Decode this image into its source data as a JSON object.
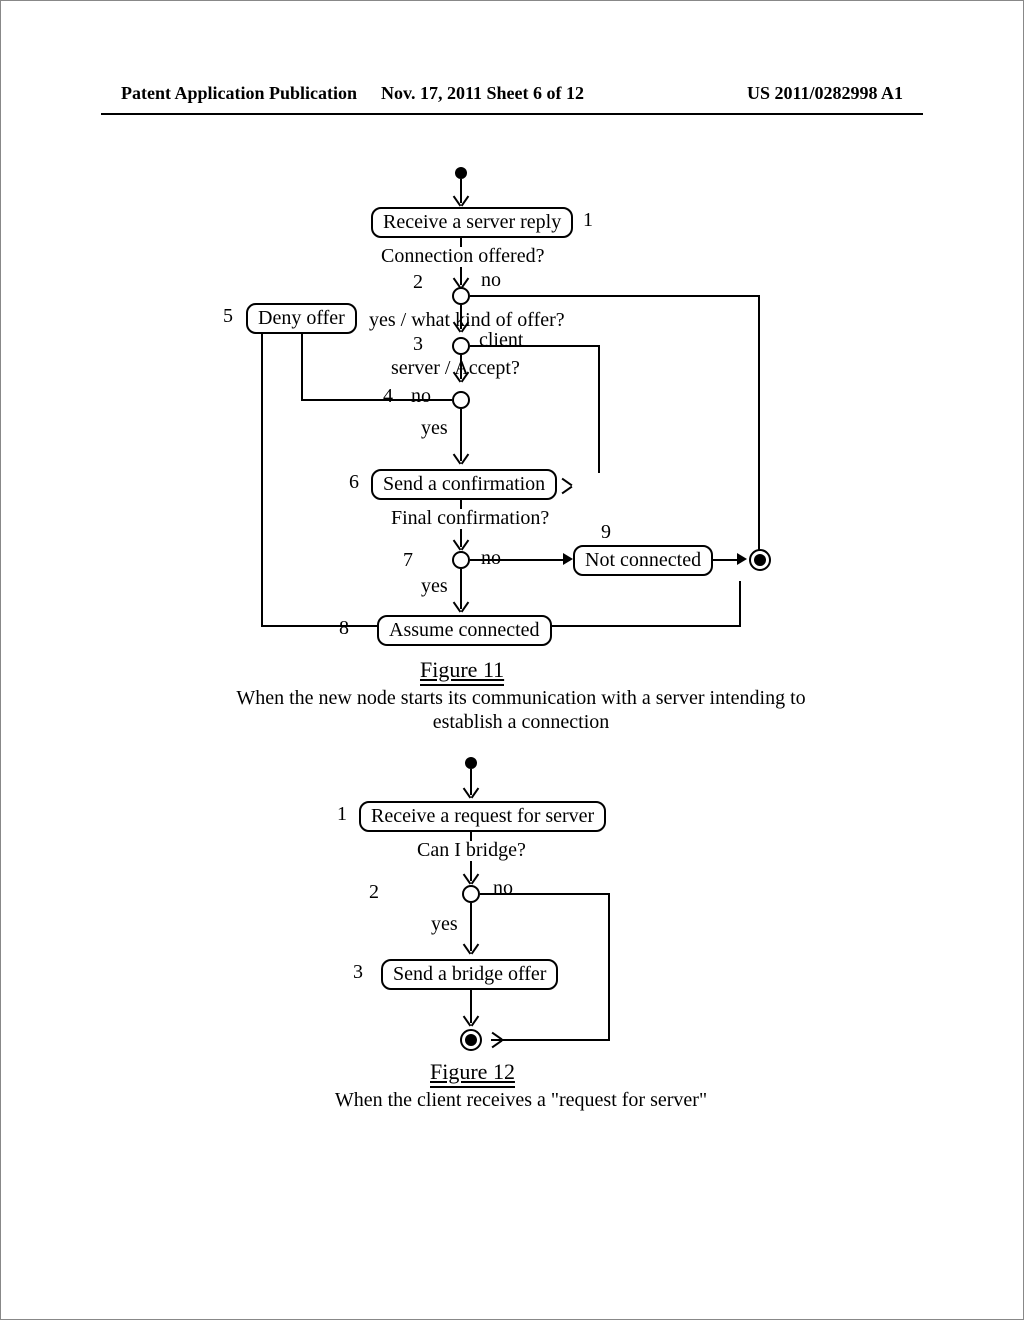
{
  "header": {
    "left": "Patent Application Publication",
    "middle": "Nov. 17, 2011  Sheet 6 of 12",
    "right": "US 2011/0282998 A1"
  },
  "figure11": {
    "title": "Figure 11",
    "caption_line1": "When the new node starts its communication with a server intending to",
    "caption_line2": "establish a connection",
    "steps": {
      "n1": {
        "num": "1",
        "box": "Receive a server reply"
      },
      "q1": "Connection offered?",
      "n2_num": "2",
      "q1_no": "no",
      "q2_yes": "yes / what kind of offer?",
      "n3_num": "3",
      "q2_client": "client",
      "q3_server": "server / Accept?",
      "n4_num": "4",
      "q3_no": "no",
      "q3_yes": "yes",
      "n5": {
        "num": "5",
        "box": "Deny offer"
      },
      "n6": {
        "num": "6",
        "box": "Send a confirmation"
      },
      "q4": "Final confirmation?",
      "n7_num": "7",
      "q4_no": "no",
      "q4_yes": "yes",
      "n9": {
        "num": "9",
        "box": "Not connected"
      },
      "n8": {
        "num": "8",
        "box": "Assume connected"
      }
    }
  },
  "figure12": {
    "title": "Figure 12",
    "caption": "When the client receives a \"request for server\"",
    "steps": {
      "n1": {
        "num": "1",
        "box": "Receive a request for server"
      },
      "q1": "Can I bridge?",
      "n2_num": "2",
      "q1_no": "no",
      "q1_yes": "yes",
      "n3": {
        "num": "3",
        "box": "Send a bridge offer"
      }
    }
  }
}
